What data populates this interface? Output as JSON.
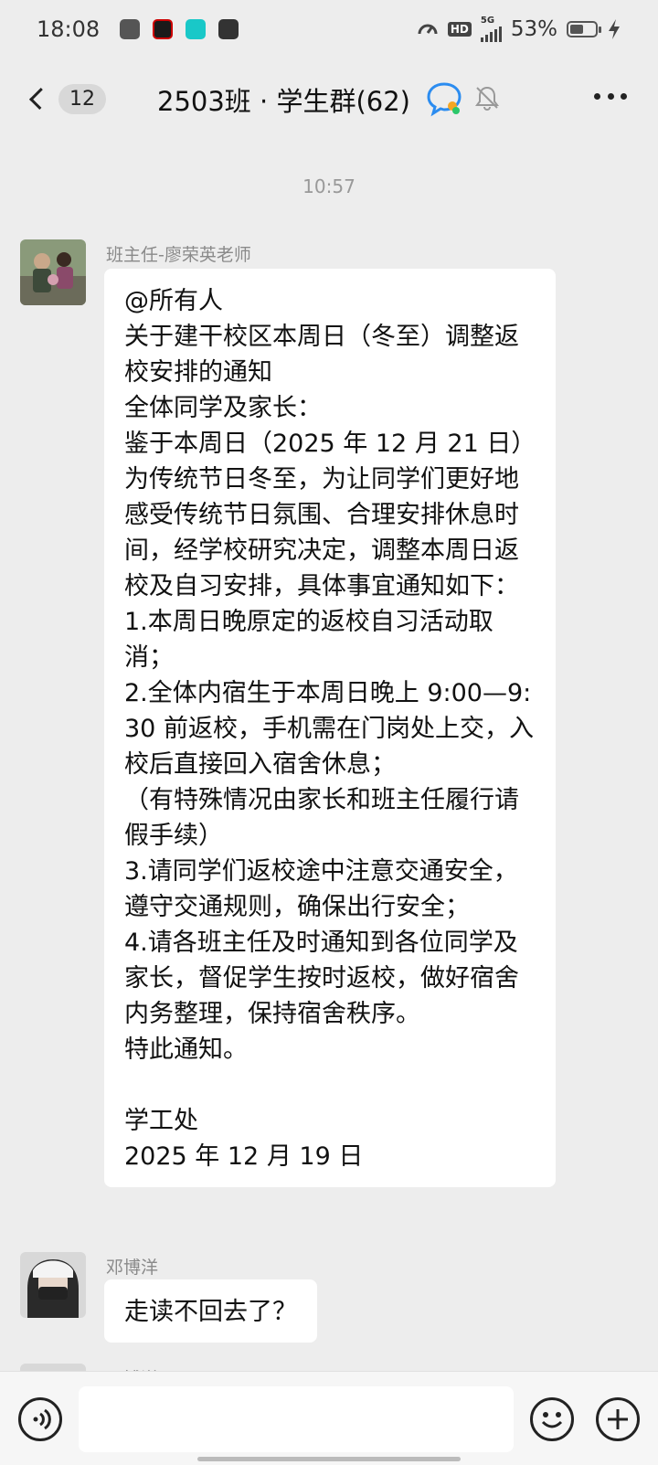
{
  "status_bar": {
    "time": "18:08",
    "network": "5G",
    "hd": "HD",
    "battery_text": "53%",
    "battery_level": 0.53
  },
  "header": {
    "unread_count": "12",
    "title": "2503班 · 学生群(62)"
  },
  "chat": {
    "timestamp": "10:57",
    "messages": [
      {
        "sender": "班主任-廖荣英老师",
        "text": "@所有人\n关于建干校区本周日（冬至）调整返校安排的通知\n全体同学及家长：\n鉴于本周日（2025 年 12 月 21 日）为传统节日冬至，为让同学们更好地感受传统节日氛围、合理安排休息时间，经学校研究决定，调整本周日返校及自习安排，具体事宜通知如下：\n1.本周日晚原定的返校自习活动取消；\n2.全体内宿生于本周日晚上 9:00—9:30 前返校，手机需在门岗处上交，入校后直接回入宿舍休息；\n（有特殊情况由家长和班主任履行请假手续）\n3.请同学们返校途中注意交通安全，遵守交通规则，确保出行安全；\n4.请各班主任及时通知到各位同学及家长，督促学生按时返校，做好宿舍内务整理，保持宿舍秩序。\n特此通知。\n\n学工处\n2025 年 12 月 19 日"
      },
      {
        "sender": "邓博洋",
        "text": "走读不回去了？"
      },
      {
        "sender": "邓博洋",
        "text": ""
      }
    ]
  },
  "input_bar": {
    "placeholder": ""
  }
}
